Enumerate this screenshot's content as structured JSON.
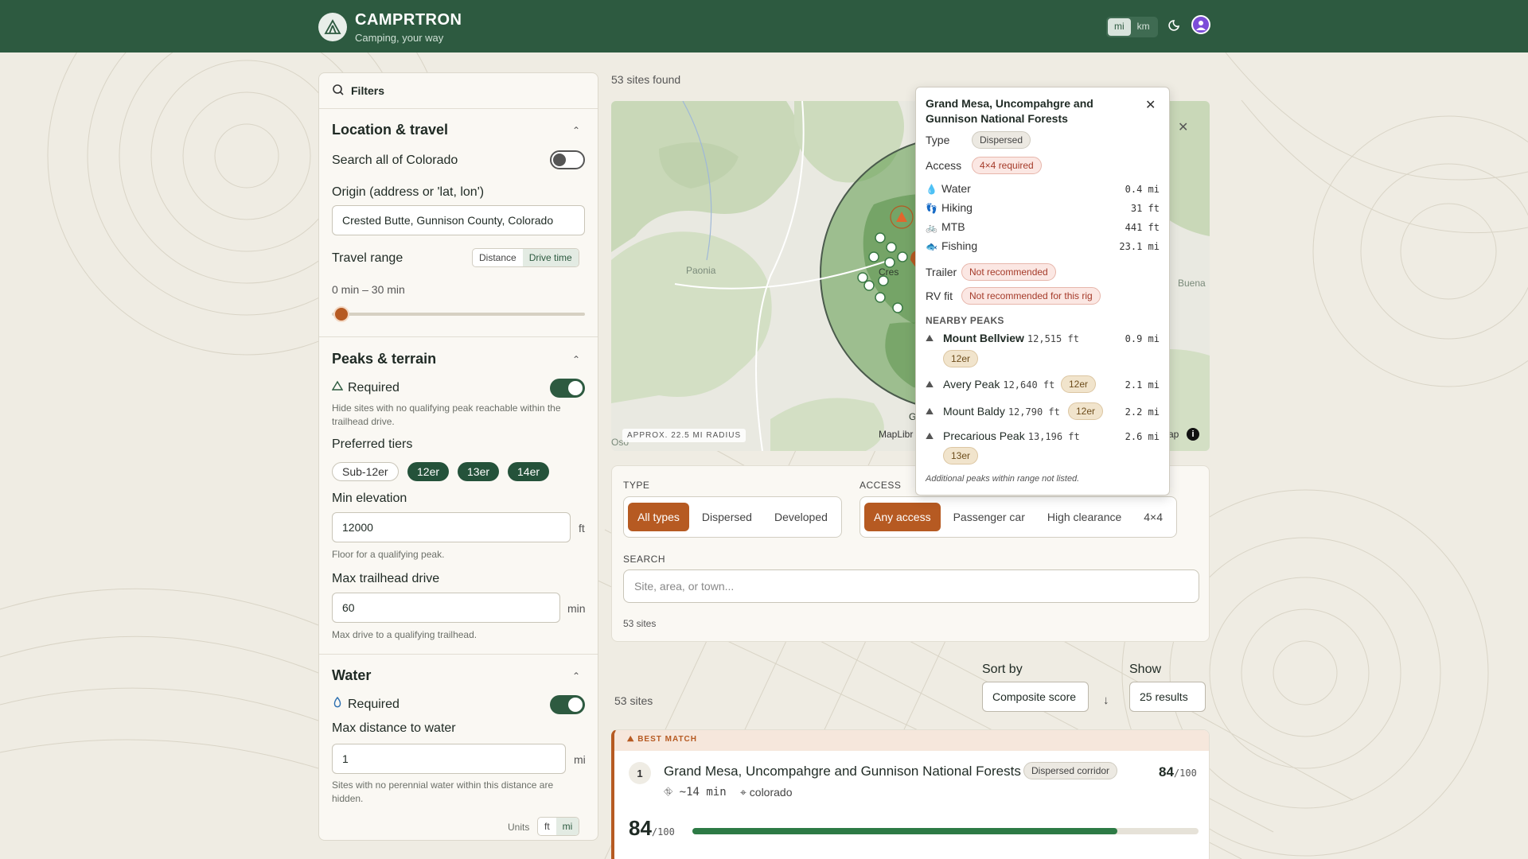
{
  "header": {
    "brand": "CAMPRTRON",
    "tagline": "Camping, your way",
    "units": [
      "mi",
      "km"
    ],
    "active_unit": "mi",
    "icons": [
      "tent-logo-icon",
      "moon-icon",
      "user-avatar-icon"
    ]
  },
  "filters": {
    "title": "Filters",
    "location": {
      "title": "Location & travel",
      "search_all_label": "Search all of Colorado",
      "search_all_on": false,
      "origin_label": "Origin (address or 'lat, lon')",
      "origin_value": "Crested Butte, Gunnison County, Colorado",
      "travel_range_label": "Travel range",
      "range_modes": [
        "Distance",
        "Drive time"
      ],
      "active_mode": "Drive time",
      "range_text": "0 min – 30 min",
      "range_fraction": 0.0
    },
    "peaks": {
      "title": "Peaks & terrain",
      "required_label": "Required",
      "required_on": true,
      "required_hint": "Hide sites with no qualifying peak reachable within the trailhead drive.",
      "tiers_label": "Preferred tiers",
      "tiers": [
        {
          "label": "Sub-12er",
          "on": false
        },
        {
          "label": "12er",
          "on": true
        },
        {
          "label": "13er",
          "on": true
        },
        {
          "label": "14er",
          "on": true
        }
      ],
      "min_elev_label": "Min elevation",
      "min_elev_value": "12000",
      "min_elev_unit": "ft",
      "min_elev_hint": "Floor for a qualifying peak.",
      "max_drive_label": "Max trailhead drive",
      "max_drive_value": "60",
      "max_drive_unit": "min",
      "max_drive_hint": "Max drive to a qualifying trailhead."
    },
    "water": {
      "title": "Water",
      "required_label": "Required",
      "required_on": true,
      "max_dist_label": "Max distance to water",
      "max_dist_value": "1",
      "max_dist_unit": "mi",
      "hint": "Sites with no perennial water within this distance are hidden.",
      "units_label": "Units",
      "units": [
        "ft",
        "mi"
      ],
      "active_unit": "mi"
    }
  },
  "results_header": "53 sites found",
  "map": {
    "radius_label": "APPROX. 22.5 MI RADIUS",
    "attribution": "MapLibr",
    "attribution_tail": "ap",
    "place_labels": [
      "Paonia",
      "Buena",
      "Oso",
      "Cres",
      "G"
    ],
    "radius_fill": "#5e9a4c"
  },
  "popup": {
    "title": "Grand Mesa, Uncompahgre and Gunnison National Forests",
    "type_label": "Type",
    "type_value": "Dispersed",
    "access_label": "Access",
    "access_value": "4×4 required",
    "stats": [
      {
        "icon": "water-drop-icon",
        "label": "Water",
        "value": "0.4 mi"
      },
      {
        "icon": "boot-icon",
        "label": "Hiking",
        "value": "31 ft"
      },
      {
        "icon": "bike-icon",
        "label": "MTB",
        "value": "441 ft"
      },
      {
        "icon": "fish-icon",
        "label": "Fishing",
        "value": "23.1 mi"
      }
    ],
    "trailer_label": "Trailer",
    "trailer_value": "Not recommended",
    "rv_label": "RV fit",
    "rv_value": "Not recommended for this rig",
    "nearby_header": "NEARBY PEAKS",
    "peaks": [
      {
        "name": "Mount Bellview",
        "elev": "12,515 ft",
        "tier": "12er",
        "dist": "0.9 mi"
      },
      {
        "name": "Avery Peak",
        "elev": "12,640 ft",
        "tier": "12er",
        "dist": "2.1 mi"
      },
      {
        "name": "Mount Baldy",
        "elev": "12,790 ft",
        "tier": "12er",
        "dist": "2.2 mi"
      },
      {
        "name": "Precarious Peak",
        "elev": "13,196 ft",
        "tier": "13er",
        "dist": "2.6 mi"
      }
    ],
    "note": "Additional peaks within range not listed."
  },
  "filter_card": {
    "type_header": "TYPE",
    "types": [
      "All types",
      "Dispersed",
      "Developed"
    ],
    "active_type": "All types",
    "access_header": "ACCESS",
    "access": [
      "Any access",
      "Passenger car",
      "High clearance",
      "4×4"
    ],
    "active_access": "Any access",
    "search_header": "SEARCH",
    "search_placeholder": "Site, area, or town...",
    "count": "53 sites"
  },
  "sort": {
    "sort_label": "Sort by",
    "sort_value": "Composite score",
    "show_label": "Show",
    "show_value": "25 results",
    "count": "53 sites"
  },
  "top_result": {
    "badge": "BEST MATCH",
    "rank": "1",
    "title": "Grand Mesa, Uncompahgre and Gunnison National Forests",
    "tag": "Dispersed corridor",
    "score": "84",
    "score_max": "/100",
    "drive": "~14 min",
    "region": "colorado",
    "score_fraction": 0.84
  },
  "colors": {
    "brand_green": "#2d5a40",
    "accent_orange": "#b65a22"
  }
}
